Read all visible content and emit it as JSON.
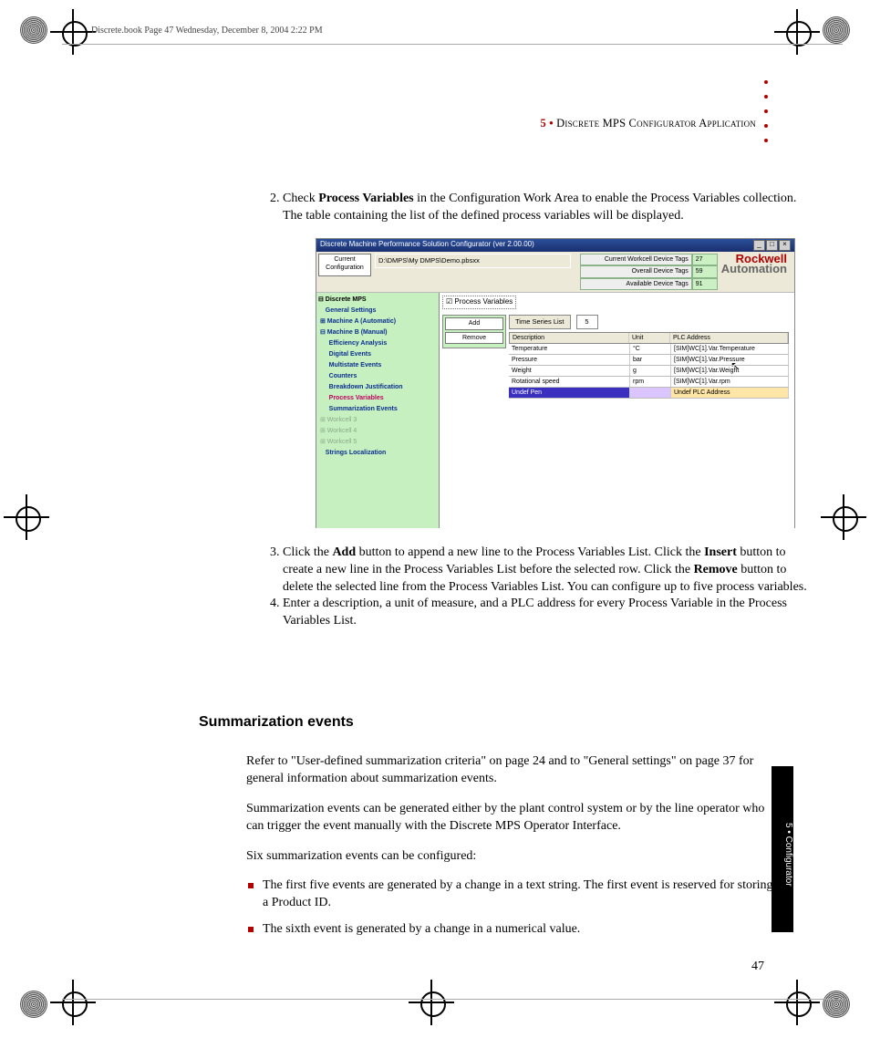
{
  "print_header": "Discrete.book  Page 47  Wednesday, December 8, 2004  2:22 PM",
  "chapter": {
    "num": "5",
    "sep": " • ",
    "title": "Discrete MPS Configurator Application"
  },
  "steps": {
    "s2_a": "Check ",
    "s2_b": "Process Variables",
    "s2_c": " in the Configuration Work Area to enable the Process Variables collection. The table containing the list of the defined process variables will be displayed.",
    "s3_a": "Click the ",
    "s3_b": "Add",
    "s3_c": " button to append a new line to the Process Variables List. Click the ",
    "s3_d": "Insert",
    "s3_e": " button to create a new line in the Process Variables List before the selected row. Click the ",
    "s3_f": "Remove",
    "s3_g": " button to delete the selected line from the Process Variables List. You can configure up to five process variables.",
    "s4": "Enter a description, a unit of measure, and a PLC address for every Process Variable in the Process Variables List."
  },
  "sect_heading": "Summarization events",
  "sect": {
    "p1": "Refer to \"User-defined summarization criteria\" on page 24 and to \"General settings\" on page 37 for general information about summarization events.",
    "p2": "Summarization events can be generated either by the plant control system or by the line operator who can trigger the event manually with the Discrete MPS Operator Interface.",
    "p3": "Six summarization events can be configured:",
    "b1": "The first five events are generated by a change in a text string. The first event is reserved for storing a Product ID.",
    "b2": "The sixth event is generated by a change in a numerical value."
  },
  "side_tab": "5 • Configurator",
  "page_number": "47",
  "screenshot": {
    "title": "Discrete Machine Performance Solution Configurator (ver 2.00.00)",
    "cfg_btn": "Current Configuration",
    "cfg_path": "D:\\DMPS\\My DMPS\\Demo.pbsxx",
    "tags": {
      "l1": "Current Workcell Device Tags",
      "v1": "27",
      "l2": "Overall Device Tags",
      "v2": "59",
      "l3": "Available Device Tags",
      "v3": "91"
    },
    "logo1": "Rockwell",
    "logo2": "Automation",
    "tree": {
      "root": "⊟ Discrete MPS",
      "n1": "    General Settings",
      "n2": " ⊞ Machine A (Automatic)",
      "n3": " ⊟ Machine B (Manual)",
      "n4": "      Efficiency Analysis",
      "n5": "      Digital Events",
      "n6": "      Multistate Events",
      "n7": "      Counters",
      "n8": "      Breakdown Justification",
      "n9": "      Process Variables",
      "n10": "      Summarization Events",
      "n11": " ⊞ Workcell 3",
      "n12": " ⊞ Workcell 4",
      "n13": " ⊞ Workcell 5",
      "n14": "    Strings Localization"
    },
    "pane_check": "☑ Process Variables",
    "btn_add": "Add",
    "btn_remove": "Remove",
    "ts_label": "Time Series List",
    "ts_count": "5",
    "cols": {
      "c1": "Description",
      "c2": "Unit",
      "c3": "PLC Address"
    },
    "rows": [
      {
        "d": "Temperature",
        "u": "°C",
        "p": "[SIM]WC[1].Var.Temperature"
      },
      {
        "d": "Pressure",
        "u": "bar",
        "p": "[SIM]WC[1].Var.Pressure"
      },
      {
        "d": "Weight",
        "u": "g",
        "p": "[SIM]WC[1].Var.Weight"
      },
      {
        "d": "Rotational speed",
        "u": "rpm",
        "p": "[SIM]WC[1].Var.rpm"
      },
      {
        "d": "Undef Pen",
        "u": "",
        "p": "Undef PLC Address"
      }
    ]
  }
}
